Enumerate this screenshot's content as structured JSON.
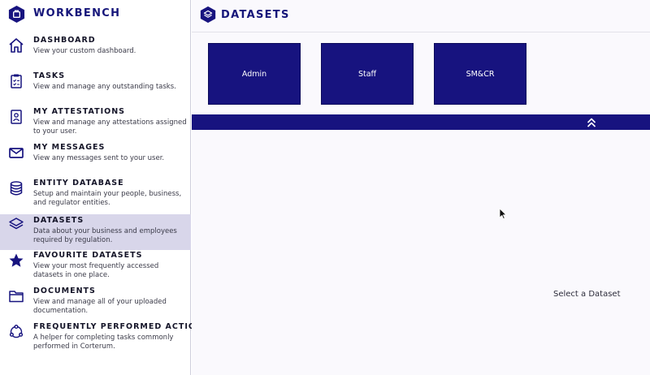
{
  "brand": {
    "title": "WORKBENCH"
  },
  "sidebar": {
    "items": [
      {
        "title": "DASHBOARD",
        "desc": "View your custom dashboard.",
        "icon": "home-icon"
      },
      {
        "title": "TASKS",
        "desc": "View and manage any outstanding tasks.",
        "icon": "clipboard-icon"
      },
      {
        "title": "MY ATTESTATIONS",
        "desc": "View and manage any attestations assigned to your user.",
        "icon": "badge-icon"
      },
      {
        "title": "MY MESSAGES",
        "desc": "View any messages sent to your user.",
        "icon": "envelope-icon"
      },
      {
        "title": "ENTITY DATABASE",
        "desc": "Setup and maintain your people, business, and regulator entities.",
        "icon": "database-icon"
      },
      {
        "title": "DATASETS",
        "desc": "Data about your business and employees required by regulation.",
        "icon": "layers-icon",
        "active": true
      },
      {
        "title": "FAVOURITE DATASETS",
        "desc": "View your most frequently accessed datasets in one place.",
        "icon": "star-icon"
      },
      {
        "title": "DOCUMENTS",
        "desc": "View and manage all of your uploaded documentation.",
        "icon": "folder-icon"
      },
      {
        "title": "FREQUENTLY PERFORMED ACTIONS",
        "desc": "A helper for completing tasks commonly performed in Corterum.",
        "icon": "cycle-icon"
      }
    ]
  },
  "main": {
    "title": "DATASETS",
    "tiles": [
      "Admin",
      "Staff",
      "SM&CR"
    ],
    "placeholder": "Select a Dataset"
  },
  "colors": {
    "accent": "#17137f",
    "active_bg": "#d8d6ea"
  }
}
